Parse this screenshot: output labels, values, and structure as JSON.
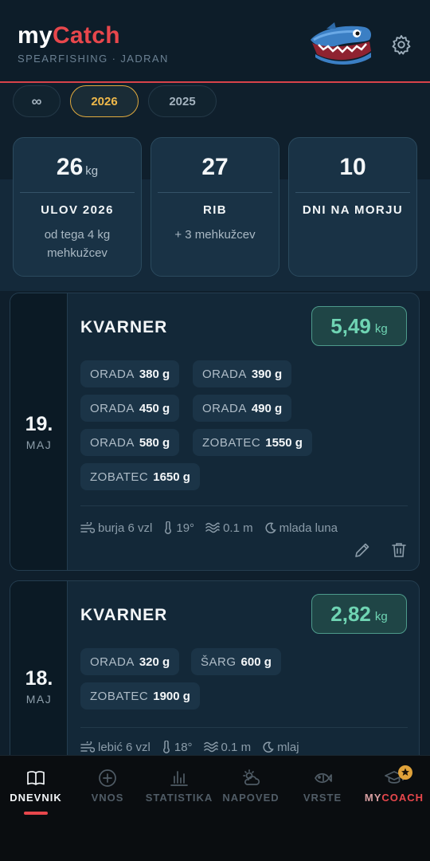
{
  "header": {
    "logo_my": "my",
    "logo_catch": "Catch",
    "subtitle": "SPEARFISHING · JADRAN",
    "icons": [
      "shark-mascot",
      "gear-icon"
    ]
  },
  "year_tabs": [
    {
      "label": "∞",
      "selected": false
    },
    {
      "label": "2026",
      "selected": true
    },
    {
      "label": "2025",
      "selected": false
    }
  ],
  "stats": [
    {
      "value": "26",
      "unit": "kg",
      "label": "ULOV 2026",
      "desc": "od tega 4 kg mehkužcev"
    },
    {
      "value": "27",
      "unit": "",
      "label": "RIB",
      "desc": "+ 3 mehkužcev"
    },
    {
      "value": "10",
      "unit": "",
      "label": "DNI NA MORJU",
      "desc": ""
    }
  ],
  "entries": [
    {
      "day": "19.",
      "month": "MAJ",
      "location": "KVARNER",
      "total": "5,49",
      "unit": "kg",
      "catches": [
        {
          "species": "ORADA",
          "weight": "380 g"
        },
        {
          "species": "ORADA",
          "weight": "390 g"
        },
        {
          "species": "ORADA",
          "weight": "450 g"
        },
        {
          "species": "ORADA",
          "weight": "490 g"
        },
        {
          "species": "ORADA",
          "weight": "580 g"
        },
        {
          "species": "ZOBATEC",
          "weight": "1550 g"
        },
        {
          "species": "ZOBATEC",
          "weight": "1650 g"
        }
      ],
      "conditions": {
        "wind": "burja 6 vzl",
        "temp": "19°",
        "waves": "0.1 m",
        "moon": "mlada luna"
      }
    },
    {
      "day": "18.",
      "month": "MAJ",
      "location": "KVARNER",
      "total": "2,82",
      "unit": "kg",
      "catches": [
        {
          "species": "ORADA",
          "weight": "320 g"
        },
        {
          "species": "ŠARG",
          "weight": "600 g"
        },
        {
          "species": "ZOBATEC",
          "weight": "1900 g"
        }
      ],
      "conditions": {
        "wind": "lebić 6 vzl",
        "temp": "18°",
        "waves": "0.1 m",
        "moon": "mlaj"
      }
    }
  ],
  "nav": [
    {
      "label": "DNEVNIK",
      "icon": "book-icon",
      "active": true
    },
    {
      "label": "VNOS",
      "icon": "plus-circle-icon",
      "active": false
    },
    {
      "label": "STATISTIKA",
      "icon": "bar-chart-icon",
      "active": false
    },
    {
      "label": "NAPOVED",
      "icon": "weather-icon",
      "active": false
    },
    {
      "label": "VRSTE",
      "icon": "fish-icon",
      "active": false
    },
    {
      "label_my": "MY",
      "label_coach": "COACH",
      "icon": "graduation-cap-icon",
      "active": false
    }
  ],
  "colors": {
    "accent_red": "#e8474c",
    "accent_gold": "#f0b94a",
    "teal": "#6fd4b3",
    "bg": "#0f1f2c"
  }
}
